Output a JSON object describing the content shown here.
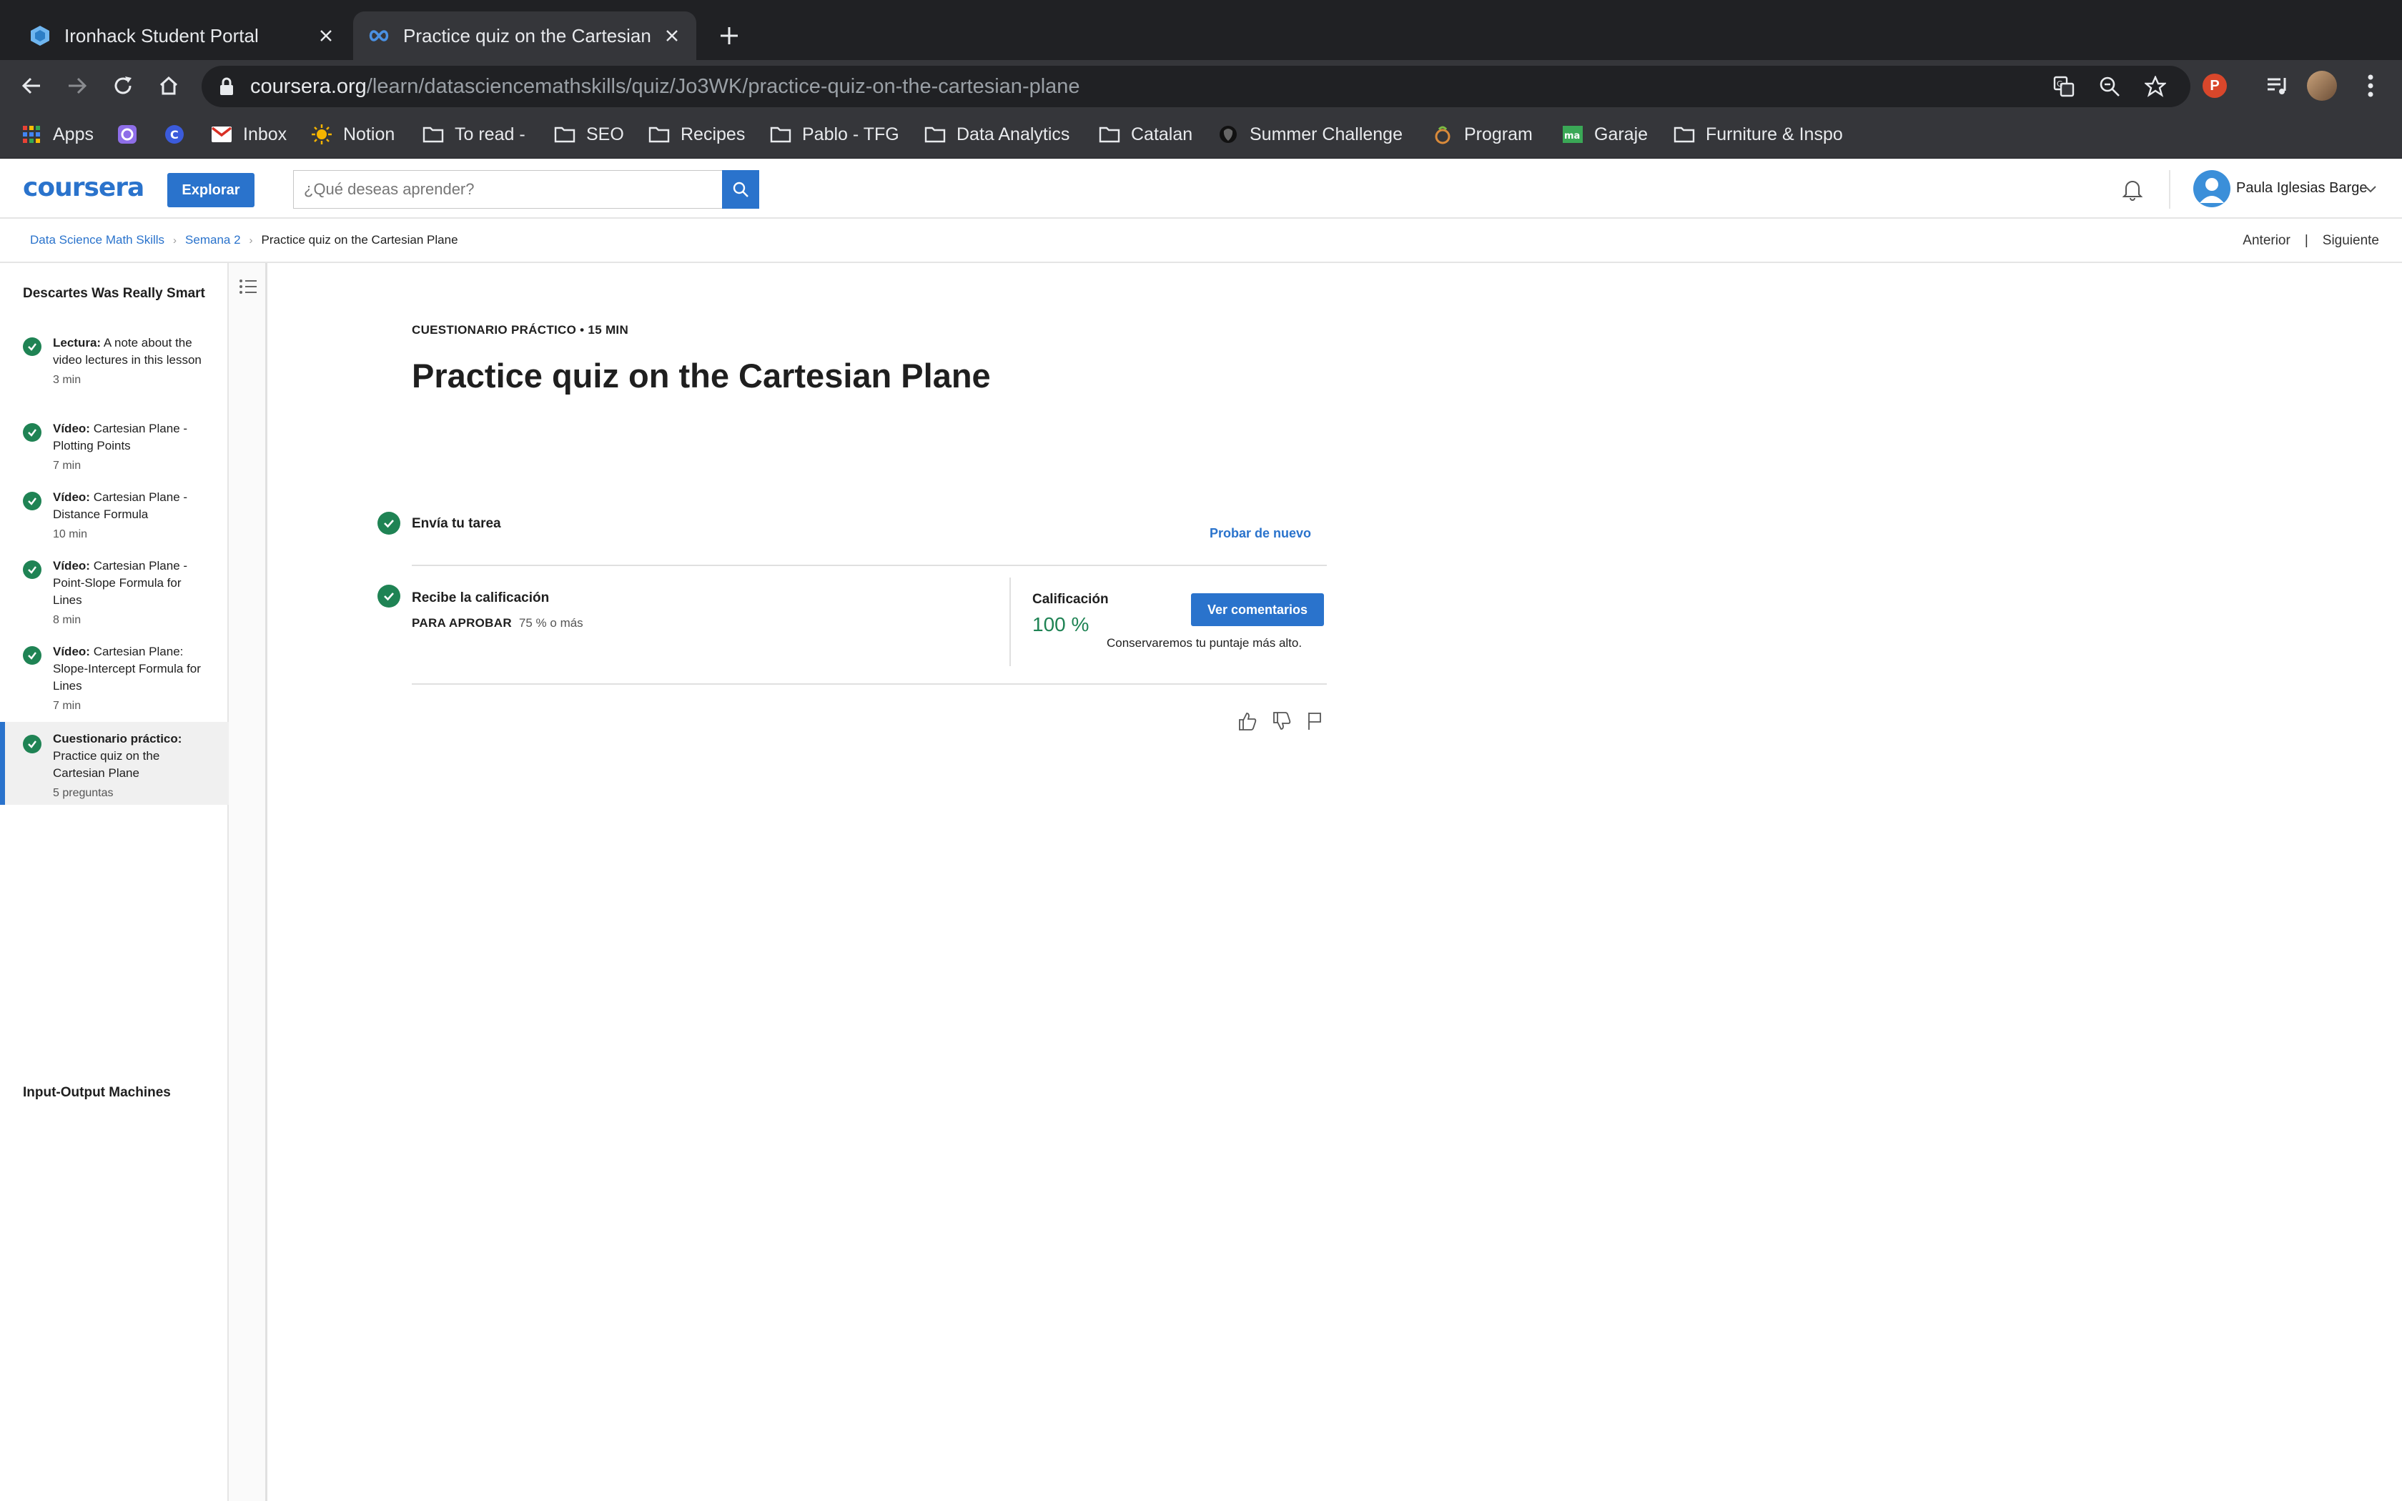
{
  "browser": {
    "tabs": [
      {
        "title": "Ironhack Student Portal",
        "active": false,
        "icon": "ironhack-hex-icon"
      },
      {
        "title": "Practice quiz on the Cartesian Plane",
        "active": true,
        "icon": "coursera-infinity-icon"
      }
    ],
    "url": {
      "domain": "coursera.org",
      "path": "/learn/datasciencemathskills/quiz/Jo3WK/practice-quiz-on-the-cartesian-plane"
    },
    "profile_initial": "P",
    "bookmarks": [
      {
        "label": "Apps",
        "icon": "apps-grid-icon"
      },
      {
        "label": "",
        "icon": "extension-icon"
      },
      {
        "label": "",
        "icon": "extension-icon"
      },
      {
        "label": "Inbox",
        "icon": "gmail-icon"
      },
      {
        "label": "Notion",
        "icon": "sun-icon"
      },
      {
        "label": "To read -",
        "icon": "folder-icon"
      },
      {
        "label": "SEO",
        "icon": "folder-icon"
      },
      {
        "label": "Recipes",
        "icon": "folder-icon"
      },
      {
        "label": "Pablo - TFG",
        "icon": "folder-icon"
      },
      {
        "label": "Data Analytics",
        "icon": "folder-icon"
      },
      {
        "label": "Catalan",
        "icon": "folder-icon"
      },
      {
        "label": "Summer Challenge",
        "icon": "site-icon"
      },
      {
        "label": "Program",
        "icon": "site-icon"
      },
      {
        "label": "Garaje",
        "icon": "ma-icon"
      },
      {
        "label": "Furniture & Inspo",
        "icon": "folder-icon"
      }
    ]
  },
  "header": {
    "logo": "coursera",
    "explore_label": "Explorar",
    "search_placeholder": "¿Qué deseas aprender?",
    "user_name": "Paula Iglesias Barge"
  },
  "breadcrumb": {
    "items": [
      "Data Science Math Skills",
      "Semana 2",
      "Practice quiz on the Cartesian Plane"
    ],
    "prev_label": "Anterior",
    "next_label": "Siguiente"
  },
  "sidebar": {
    "lesson_title": "Descartes Was Really Smart",
    "items": [
      {
        "type": "Lectura:",
        "title": "A note about the video lectures in this lesson",
        "duration": "3 min",
        "completed": true,
        "active": false
      },
      {
        "type": "Vídeo:",
        "title": "Cartesian Plane - Plotting Points",
        "duration": "7 min",
        "completed": true,
        "active": false
      },
      {
        "type": "Vídeo:",
        "title": "Cartesian Plane - Distance Formula",
        "duration": "10 min",
        "completed": true,
        "active": false
      },
      {
        "type": "Vídeo:",
        "title": "Cartesian Plane - Point-Slope Formula for Lines",
        "duration": "8 min",
        "completed": true,
        "active": false
      },
      {
        "type": "Vídeo:",
        "title": "Cartesian Plane: Slope-Intercept Formula for Lines",
        "duration": "7 min",
        "completed": true,
        "active": false
      },
      {
        "type": "Cuestionario práctico:",
        "title": "Practice quiz on the Cartesian Plane",
        "duration": "5 preguntas",
        "completed": true,
        "active": true
      }
    ],
    "next_lesson": "Input-Output Machines"
  },
  "main": {
    "kicker": "CUESTIONARIO PRÁCTICO • 15 MIN",
    "title": "Practice quiz on the Cartesian Plane",
    "submit_step": {
      "label": "Envía tu tarea",
      "retry_label": "Probar de nuevo"
    },
    "grade_step": {
      "label": "Recibe la calificación",
      "pass_key": "PARA APROBAR",
      "pass_value": "75 % o más",
      "grade_label": "Calificación",
      "grade_value": "100 %",
      "feedback_button": "Ver comentarios",
      "keep_note": "Conservaremos tu puntaje más alto."
    }
  },
  "colors": {
    "brand": "#2a73cc",
    "success": "#1f8354"
  }
}
